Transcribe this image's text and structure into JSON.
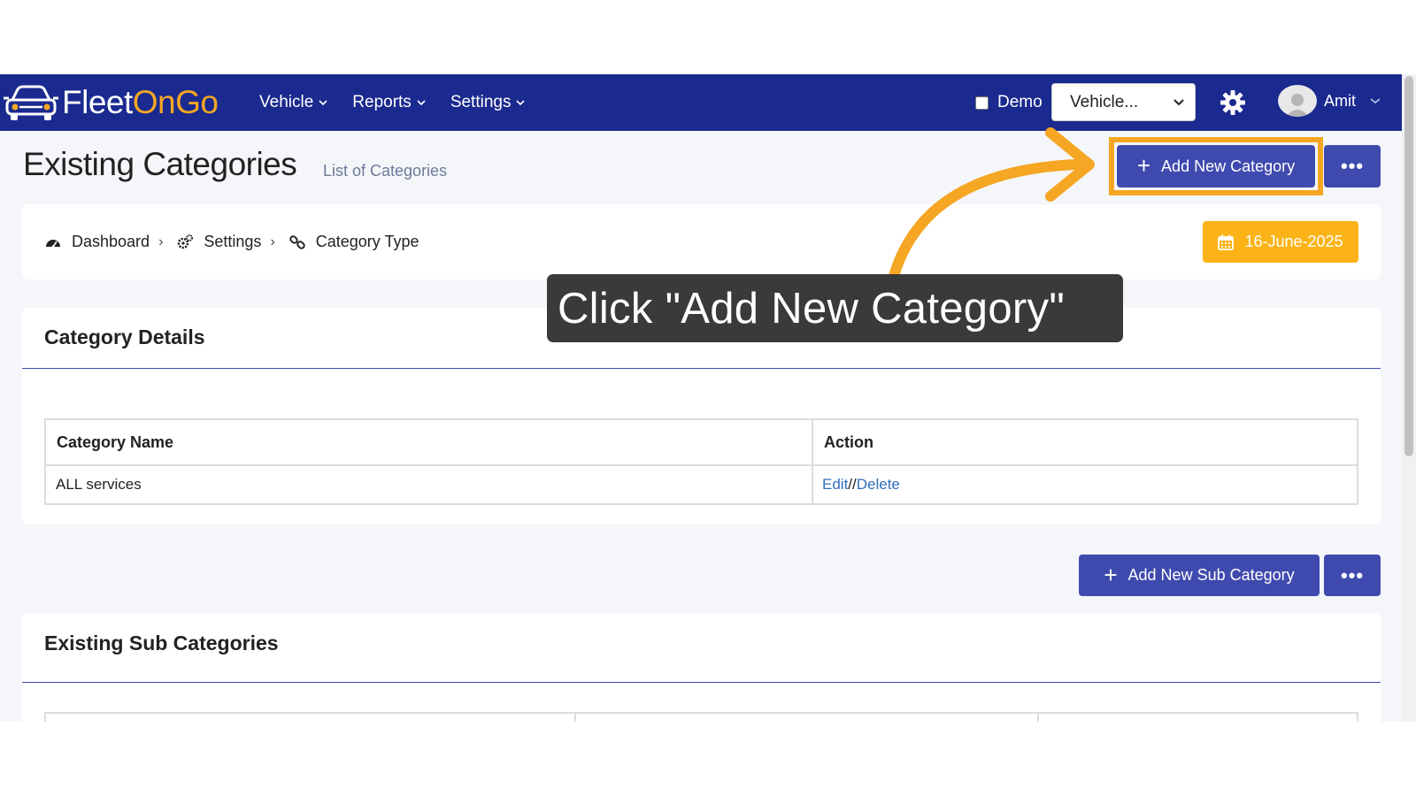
{
  "app": {
    "logo": {
      "part1": "Fleet",
      "part2": "OnGo"
    },
    "nav": [
      {
        "label": "Vehicle"
      },
      {
        "label": "Reports"
      },
      {
        "label": "Settings"
      }
    ],
    "demo_label": "Demo",
    "vehicle_select": "Vehicle...",
    "user_name": "Amit"
  },
  "page": {
    "title": "Existing Categories",
    "subtitle": "List of Categories",
    "add_category_label": "Add New Category",
    "add_sub_category_label": "Add New Sub Category",
    "more_label": "•••"
  },
  "breadcrumb": {
    "items": [
      {
        "label": "Dashboard"
      },
      {
        "label": "Settings"
      },
      {
        "label": "Category Type"
      }
    ],
    "separator": "›",
    "date": "16-June-2025"
  },
  "category_details": {
    "title": "Category Details",
    "columns": [
      "Category Name",
      "Action"
    ],
    "rows": [
      {
        "name": "ALL services",
        "edit": "Edit",
        "sep": "//",
        "delete": "Delete"
      }
    ]
  },
  "sub_categories": {
    "title": "Existing Sub Categories"
  },
  "callout": {
    "text": "Click \"Add New Category\""
  },
  "colors": {
    "navbar": "#1b2a8f",
    "primary_button": "#3f4aae",
    "accent": "#f5a623",
    "date_button": "#fbb317",
    "callout_bg": "#3a3a3a",
    "link": "#2f6fb8"
  }
}
